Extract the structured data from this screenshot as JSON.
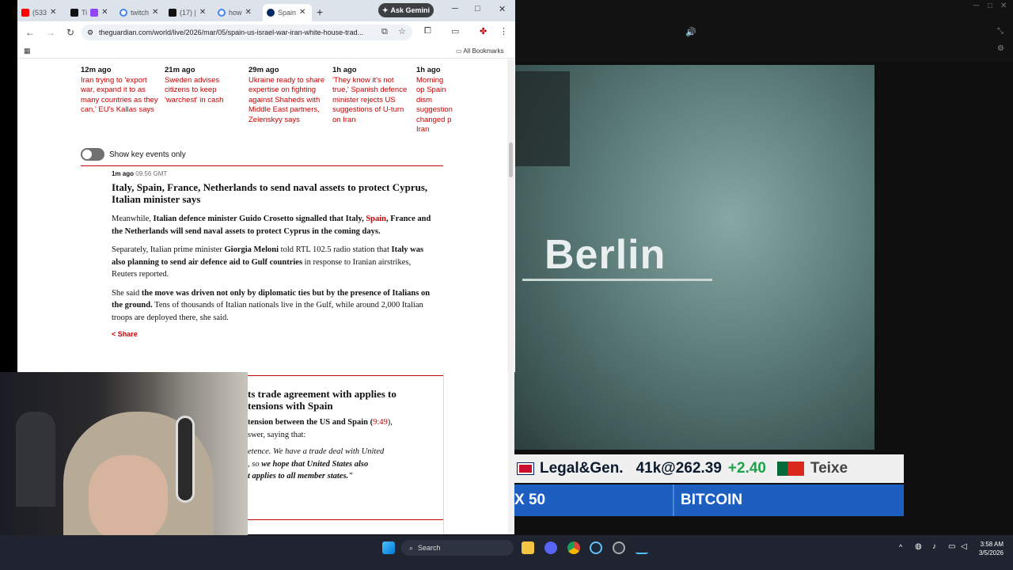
{
  "browser": {
    "tabs": [
      {
        "label": "(533",
        "favicon": "youtube-icon",
        "color": "#ff0000"
      },
      {
        "label": "Ti",
        "favicon": "tiktok-icon",
        "color": "#111111"
      },
      {
        "label": "twitch",
        "favicon": "google-icon",
        "color": "#4285f4"
      },
      {
        "label": "(17) |",
        "favicon": "x-icon",
        "color": "#111111"
      },
      {
        "label": "how",
        "favicon": "google-icon",
        "color": "#4285f4"
      },
      {
        "label": "Spain",
        "favicon": "guardian-icon",
        "color": "#052962"
      }
    ],
    "ask_gemini": "Ask Gemini",
    "url": "theguardian.com/world/live/2026/mar/05/spain-us-israel-war-iran-white-house-trad...",
    "all_bookmarks": "All Bookmarks"
  },
  "key_events": [
    {
      "time": "12m ago",
      "text": "Iran trying to 'export war, expand it to as many countries as they can,' EU's Kallas says"
    },
    {
      "time": "21m ago",
      "text": "Sweden advises citizens to keep 'warchest' in cash"
    },
    {
      "time": "29m ago",
      "text": "Ukraine ready to share expertise on fighting against Shaheds with Middle East partners, Zelenskyy says"
    },
    {
      "time": "1h ago",
      "text": "'They know it's not true,' Spanish defence minister rejects US suggestions of U-turn on Iran"
    },
    {
      "time": "1h ago",
      "text": "Morning op Spain dism suggestion changed p Iran"
    }
  ],
  "toggle_label": "Show key events only",
  "post": {
    "ago": "1m ago",
    "time": "09.56 GMT",
    "headline": "Italy, Spain, France, Netherlands to send naval assets to protect Cyprus, Italian minister says",
    "p1_a": "Meanwhile, ",
    "p1_b": "Italian defence minister Guido Crosetto signalled that Italy, ",
    "p1_link": "Spain",
    "p1_c": ", France and the Netherlands will send naval assets to protect Cyprus in the coming days.",
    "p2_a": "Separately, Italian prime minister ",
    "p2_b": "Giorgia Meloni",
    "p2_c": " told RTL 102.5 radio station that ",
    "p2_d": "Italy was also planning to send air defence aid to Gulf countries",
    "p2_e": " in response to Iranian airstrikes, Reuters reported.",
    "p3_a": "She said ",
    "p3_b": "the move was driven not only by diplomatic ties but by the presence of Italians on the ground.",
    "p3_c": " Tens of thousands of Italian nationals live in the Gulf, while around 2,000 Italian troops are deployed there, she said.",
    "share": "Share"
  },
  "lower_post": {
    "headline_l1": "ts trade agreement with applies to",
    "headline_l2": "tensions with Spain",
    "line1_a": "tension between the US and Spain (",
    "line1_link": "9:49",
    "line1_b": "),",
    "line2": "swer, saying that:",
    "q1": "etence. We have a trade deal with United",
    "q2_a": ", so ",
    "q2_b": "we hope that United States also",
    "q3": "t applies to all member states.\""
  },
  "tv": {
    "city": "Berlin",
    "ticker_name": "Legal&Gen.",
    "ticker_qty": "41k@262.39",
    "ticker_change": "+2.40",
    "ticker_next": "Teixe",
    "index_label": "X 50",
    "bitcoin": "BITCOIN"
  },
  "taskbar": {
    "search": "Search",
    "time": "3:58 AM",
    "date": "3/5/2026"
  }
}
